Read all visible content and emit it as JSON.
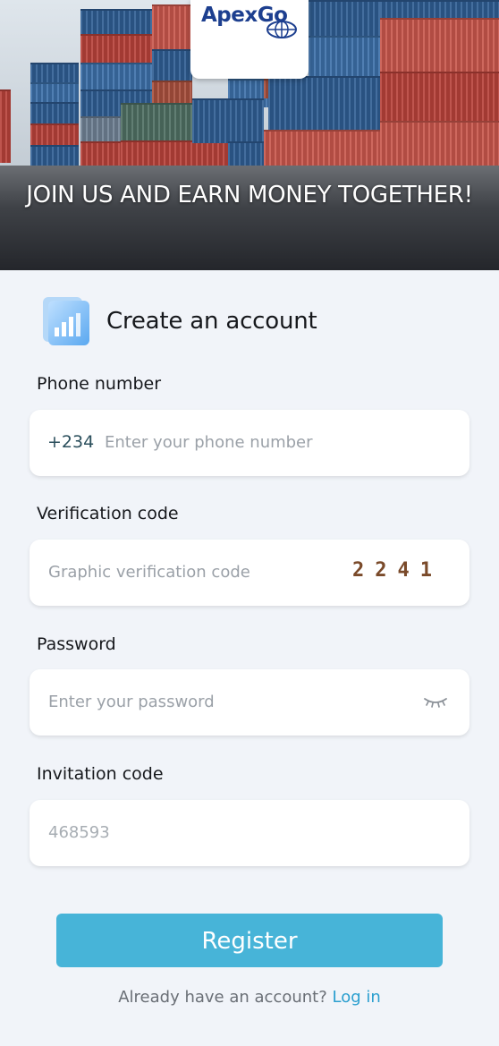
{
  "hero": {
    "logo_text": "ApexGo",
    "tagline": "JOIN US AND EARN MONEY TOGETHER!"
  },
  "form": {
    "title": "Create an account",
    "phone": {
      "label": "Phone number",
      "prefix": "+234",
      "placeholder": "Enter your phone number"
    },
    "verification": {
      "label": "Verification code",
      "placeholder": "Graphic verification code",
      "captcha": "2241"
    },
    "password": {
      "label": "Password",
      "placeholder": "Enter your password",
      "toggle_icon": "eye-closed-icon"
    },
    "invitation": {
      "label": "Invitation code",
      "value": "468593"
    },
    "register_label": "Register",
    "footer_text": "Already have an account?",
    "login_label": "Log in"
  },
  "colors": {
    "accent": "#47b4d8",
    "link": "#2b9fcf",
    "background": "#f1f4f9"
  }
}
